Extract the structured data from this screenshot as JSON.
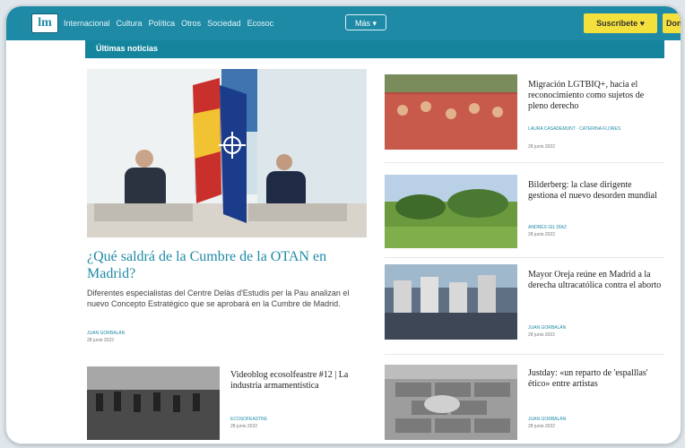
{
  "header": {
    "logo_text": "lm",
    "nav": [
      "Internacional",
      "Cultura",
      "Política",
      "Otros",
      "Sociedad",
      "Ecosoc"
    ],
    "more_label": "Más ▾",
    "subscribe_label": "Suscríbete ♥",
    "donate_label": "Dona",
    "colors": {
      "bar": "#1f8aa6",
      "button": "#f3e03c"
    }
  },
  "section": {
    "title": "Últimas noticias"
  },
  "lead": {
    "headline": "¿Qué saldrá de la Cumbre de la OTAN en Madrid?",
    "summary": "Diferentes especialistas del Centre Delàs d'Estudis per la Pau analizan el nuevo Concepto Estratégico que se aprobará en la Cumbre de Madrid.",
    "author": "Juan Gorbalán",
    "date": "28 junio 2022"
  },
  "side_articles": [
    {
      "title": "Migración LGTBIQ+, hacia el reconocimiento como sujetos de pleno derecho",
      "author": "Laura Casademunt · Caterina Flores",
      "date": "28 junio 2022"
    },
    {
      "title": "Bilderberg: la clase dirigente gestiona el nuevo desorden mundial",
      "author": "Andrés Gil Díaz",
      "date": "28 junio 2022"
    },
    {
      "title": "Mayor Oreja reúne en Madrid a la derecha ultracatólica contra el aborto",
      "author": "Juan Gorbalán",
      "date": "28 junio 2022"
    },
    {
      "title": "Justday: «un reparto de 'espalllas' ético» entre artistas",
      "author": "Juan Gorbalán",
      "date": "28 junio 2022"
    }
  ],
  "bottom_article": {
    "title": "Videoblog ecosolfeastre #12 | La industria armamentística",
    "author": "Ecosofeastre",
    "date": "28 junio 2022"
  }
}
